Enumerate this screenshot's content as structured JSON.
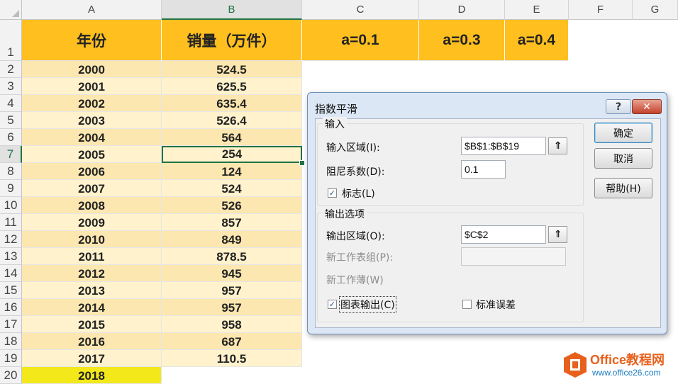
{
  "columns": [
    "A",
    "B",
    "C",
    "D",
    "E",
    "F",
    "G"
  ],
  "rows": [
    "1",
    "2",
    "3",
    "4",
    "5",
    "6",
    "7",
    "8",
    "9",
    "10",
    "11",
    "12",
    "13",
    "14",
    "15",
    "16",
    "17",
    "18",
    "19",
    "20"
  ],
  "header": {
    "year": "年份",
    "sales": "销量（万件）",
    "c": "a=0.1",
    "d": "a=0.3",
    "e": "a=0.4"
  },
  "data": [
    {
      "year": "2000",
      "sales": "524.5"
    },
    {
      "year": "2001",
      "sales": "625.5"
    },
    {
      "year": "2002",
      "sales": "635.4"
    },
    {
      "year": "2003",
      "sales": "526.4"
    },
    {
      "year": "2004",
      "sales": "564"
    },
    {
      "year": "2005",
      "sales": "254"
    },
    {
      "year": "2006",
      "sales": "124"
    },
    {
      "year": "2007",
      "sales": "524"
    },
    {
      "year": "2008",
      "sales": "526"
    },
    {
      "year": "2009",
      "sales": "857"
    },
    {
      "year": "2010",
      "sales": "849"
    },
    {
      "year": "2011",
      "sales": "878.5"
    },
    {
      "year": "2012",
      "sales": "945"
    },
    {
      "year": "2013",
      "sales": "957"
    },
    {
      "year": "2014",
      "sales": "957"
    },
    {
      "year": "2015",
      "sales": "958"
    },
    {
      "year": "2016",
      "sales": "687"
    },
    {
      "year": "2017",
      "sales": "110.5"
    },
    {
      "year": "2018",
      "sales": ""
    }
  ],
  "selected_cell": "B7",
  "dialog": {
    "title": "指数平滑",
    "help_glyph": "?",
    "close_glyph": "✕",
    "input_group": "输入",
    "input_range_label": "输入区域(I):",
    "input_range_value": "$B$1:$B$19",
    "damping_label": "阻尼系数(D):",
    "damping_value": "0.1",
    "labels_checkbox": "标志(L)",
    "labels_checked": true,
    "output_group": "输出选项",
    "output_range_label": "输出区域(O):",
    "output_range_value": "$C$2",
    "new_sheet_label": "新工作表组(P):",
    "new_workbook_label": "新工作薄(W)",
    "chart_output_label": "图表输出(C)",
    "chart_output_checked": true,
    "std_error_label": "标准误差",
    "std_error_checked": false,
    "ok_button": "确定",
    "cancel_button": "取消",
    "help_button": "帮助(H)",
    "ref_icon": "⇑"
  },
  "watermark": {
    "line1": "Office教程网",
    "line2": "www.office26.com",
    "logo_color": "#e8611c"
  }
}
